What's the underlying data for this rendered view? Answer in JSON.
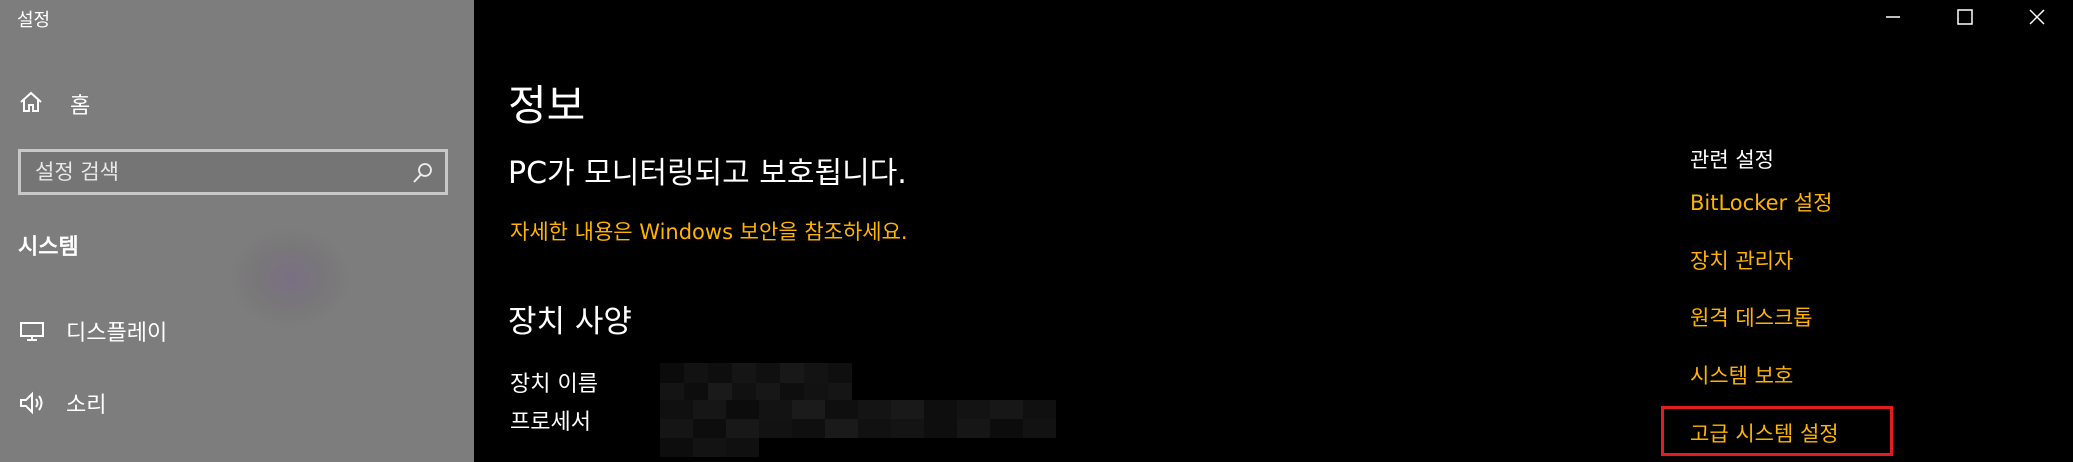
{
  "window": {
    "title": "설정"
  },
  "sidebar": {
    "home_label": "홈",
    "search_placeholder": "설정 검색",
    "section_label": "시스템",
    "items": [
      {
        "label": "디스플레이",
        "icon": "monitor-icon"
      },
      {
        "label": "소리",
        "icon": "speaker-icon"
      }
    ]
  },
  "main": {
    "title": "정보",
    "protection_status": "PC가 모니터링되고 보호됩니다.",
    "security_link": "자세한 내용은 Windows 보안을 참조하세요.",
    "specs_title": "장치 사양",
    "spec_labels": [
      "장치 이름",
      "프로세서"
    ]
  },
  "related": {
    "title": "관련 설정",
    "links": [
      "BitLocker 설정",
      "장치 관리자",
      "원격 데스크톱",
      "시스템 보호",
      "고급 시스템 설정"
    ],
    "highlighted_index": 4
  },
  "colors": {
    "accent": "#ffb300",
    "highlight": "#e11d1d",
    "sidebar_bg": "#7d7d7d",
    "main_bg": "#000000"
  }
}
